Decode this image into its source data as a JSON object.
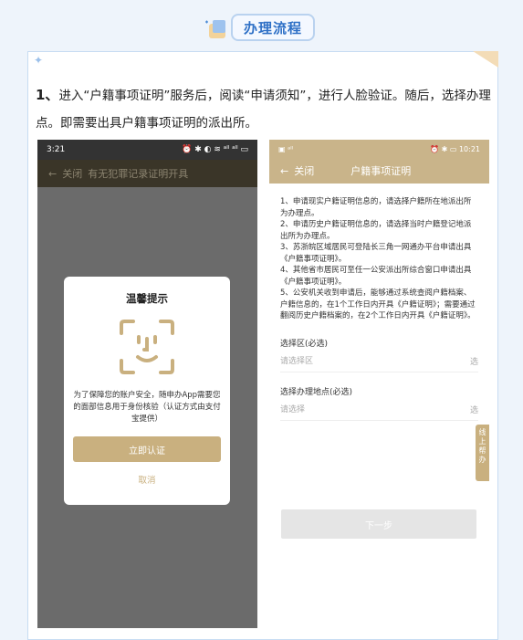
{
  "header": {
    "title": "办理流程"
  },
  "step": {
    "number": "1、",
    "text": "进入“户籍事项证明”服务后，阅读“申请须知”，进行人脸验证。随后，选择办理点。即需要出具户籍事项证明的派出所。"
  },
  "left_phone": {
    "status_time": "3:21",
    "status_icons": "⏰ ✱ ◐ ≋ ᵃˡˡ ᵃˡˡ ▭",
    "nav_back": "←",
    "nav_close": "关闭",
    "nav_title": "有无犯罪记录证明开具",
    "dialog": {
      "title": "温馨提示",
      "description": "为了保障您的账户安全，随申办App需要您的面部信息用于身份核验（认证方式由支付宝提供）",
      "confirm_label": "立即认证",
      "cancel_label": "取消"
    }
  },
  "right_phone": {
    "status_left": "▣ ᵃˡˡ",
    "status_right": "⏰ ✱ ▭ 10:21",
    "nav_back": "←",
    "nav_close": "关闭",
    "nav_title": "户籍事项证明",
    "notices": [
      "1、申请现实户籍证明信息的，请选择户籍所在地派出所为办理点。",
      "2、申请历史户籍证明信息的，请选择当时户籍登记地派出所为办理点。",
      "3、苏浙皖区域居民可登陆长三角一网通办平台申请出具《户籍事项证明》。",
      "4、其他省市居民可至任一公安派出所综合窗口申请出具《户籍事项证明》。",
      "5、公安机关收到申请后，能够通过系统查阅户籍档案、户籍信息的，在1个工作日内开具《户籍证明》；需要通过翻阅历史户籍档案的，在2个工作日内开具《户籍证明》。"
    ],
    "district": {
      "label": "选择区(必选)",
      "placeholder": "请选择区",
      "right": "选"
    },
    "location": {
      "label": "选择办理地点(必选)",
      "placeholder": "请选择",
      "right": "选"
    },
    "help_tab": "线上帮办",
    "next_label": "下一步"
  }
}
